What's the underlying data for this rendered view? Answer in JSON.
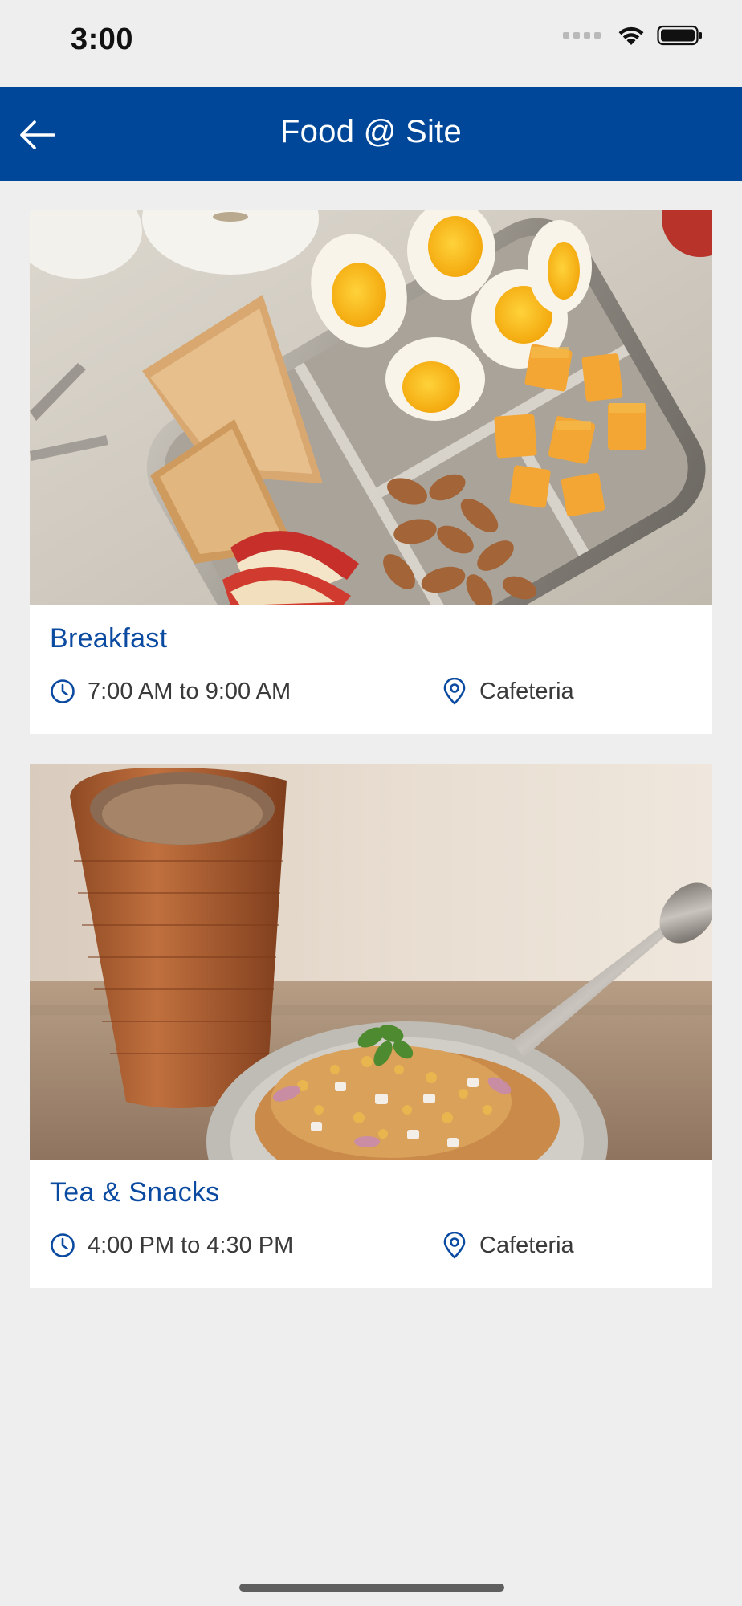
{
  "status_bar": {
    "time": "3:00"
  },
  "app_bar": {
    "title": "Food @ Site",
    "back_icon": "arrow-left-icon",
    "background_color": "#00479a"
  },
  "cards": [
    {
      "title": "Breakfast",
      "time": "7:00 AM to 9:00 AM",
      "location": "Cafeteria",
      "image": "breakfast-bento-box-photo"
    },
    {
      "title": "Tea & Snacks",
      "time": "4:00 PM to 4:30 PM",
      "location": "Cafeteria",
      "image": "chai-and-snack-plate-photo"
    }
  ],
  "colors": {
    "accent": "#0a4aa0",
    "background": "#eeeeee",
    "card": "#ffffff"
  }
}
